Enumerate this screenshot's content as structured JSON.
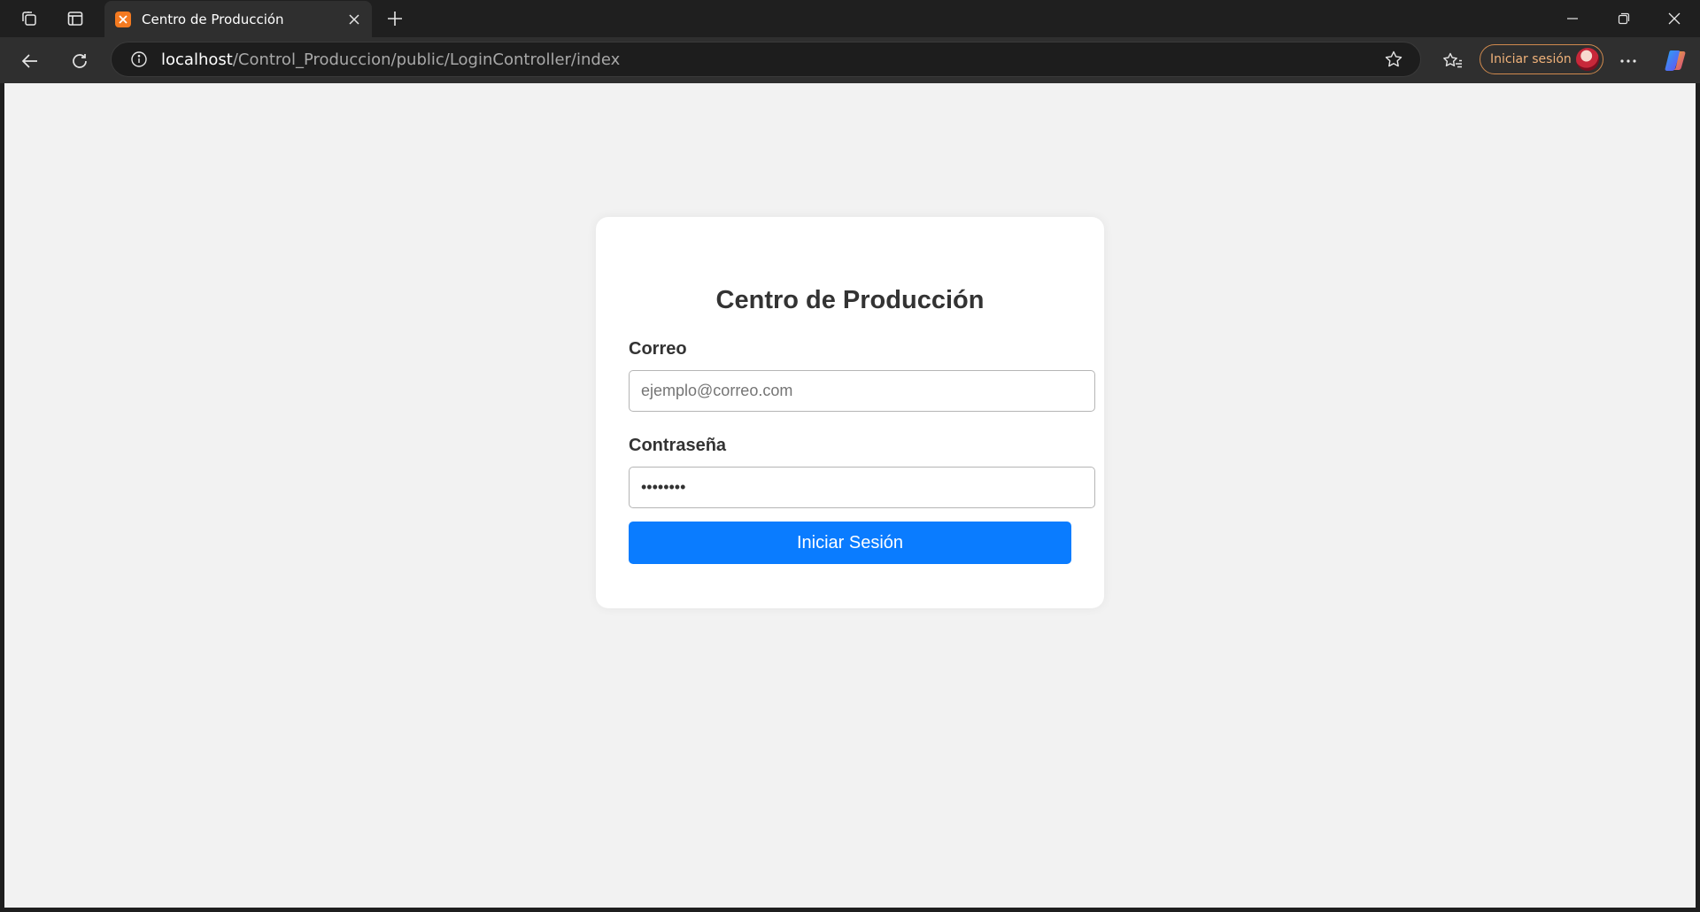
{
  "browser": {
    "tab": {
      "title": "Centro de Producción"
    },
    "url": {
      "host": "localhost",
      "path": "/Control_Produccion/public/LoginController/index"
    },
    "signin_label": "Iniciar sesión",
    "icons": {
      "workspaces": "workspaces-icon",
      "tab_actions": "tab-actions-icon",
      "favicon": "xampp-icon",
      "close_tab": "close-icon",
      "new_tab": "plus-icon",
      "minimize": "minimize-icon",
      "restore": "restore-icon",
      "close_window": "close-icon",
      "back": "back-arrow-icon",
      "refresh": "refresh-icon",
      "site_info": "info-icon",
      "favorite": "star-icon",
      "favorites": "favorites-icon",
      "more": "more-icon",
      "copilot": "copilot-icon"
    },
    "colors": {
      "frame": "#1f1f1f",
      "toolbar": "#2f2f2f",
      "signin_accent": "#d08a4e"
    }
  },
  "login": {
    "title": "Centro de Producción",
    "email_label": "Correo",
    "email_placeholder": "ejemplo@correo.com",
    "password_label": "Contraseña",
    "password_value": "••••••••",
    "submit_label": "Iniciar Sesión",
    "colors": {
      "page_bg": "#f2f2f2",
      "card_bg": "#ffffff",
      "button": "#0a7cff",
      "text": "#333333"
    }
  }
}
